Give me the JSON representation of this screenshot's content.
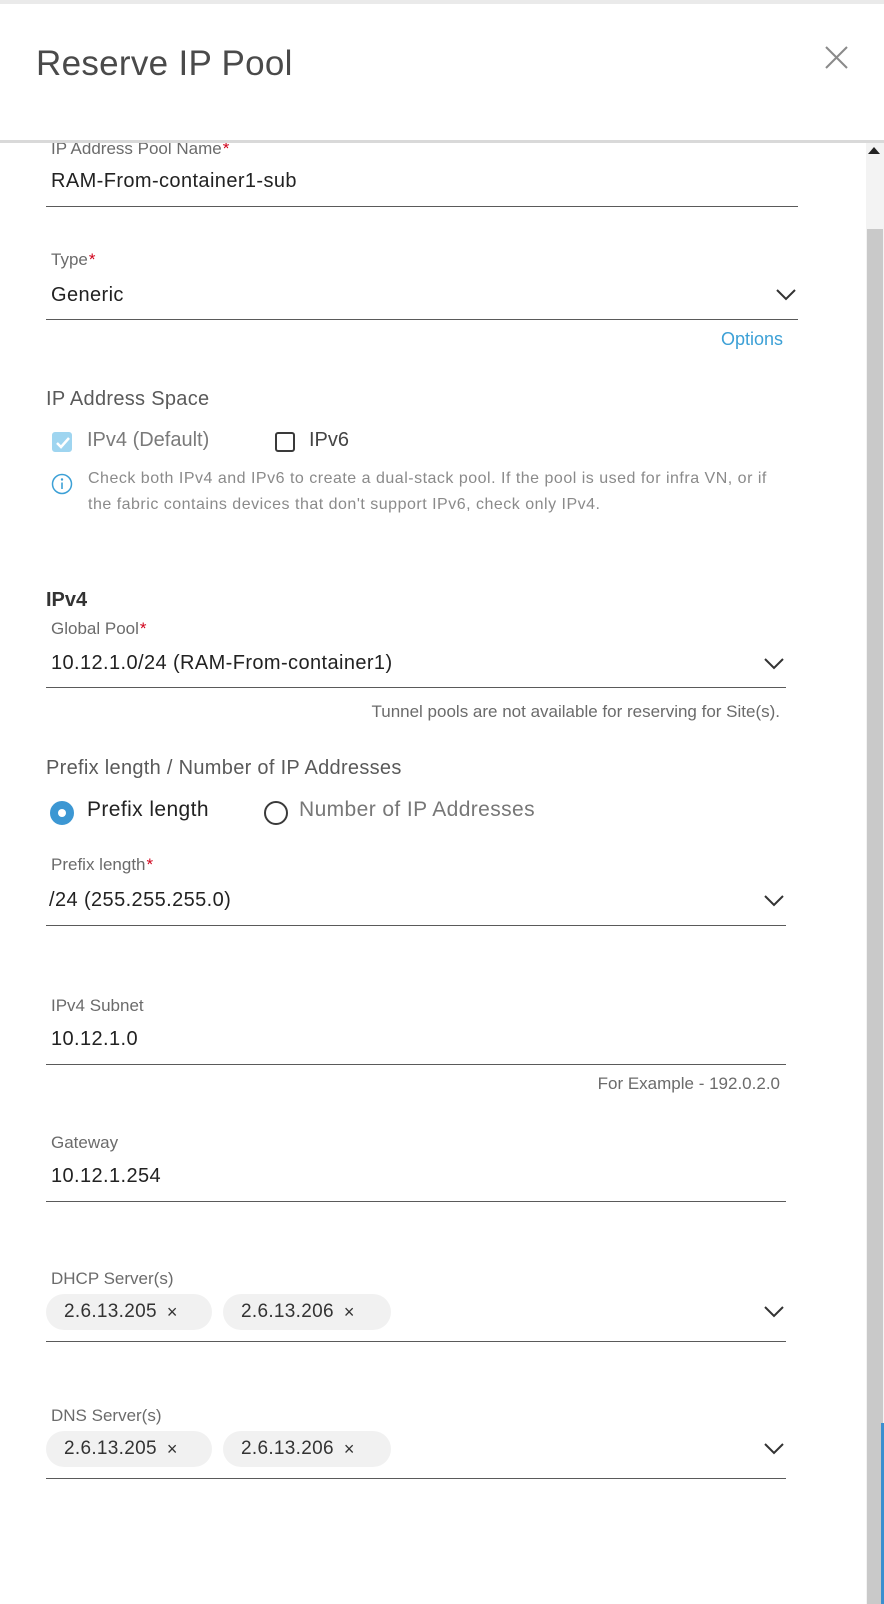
{
  "header": {
    "title": "Reserve IP Pool"
  },
  "pool_name": {
    "label": "IP Address Pool Name",
    "required": "*",
    "value": "RAM-From-container1-sub"
  },
  "type": {
    "label": "Type",
    "required": "*",
    "value": "Generic",
    "options_link": "Options"
  },
  "ip_space": {
    "title": "IP Address Space",
    "ipv4_label": "IPv4 (Default)",
    "ipv4_checked": true,
    "ipv6_label": "IPv6",
    "ipv6_checked": false,
    "info": "Check both IPv4 and IPv6 to create a dual-stack pool. If the pool is used for infra VN, or if the fabric contains devices that don't support IPv6, check only IPv4."
  },
  "ipv4": {
    "heading": "IPv4",
    "global_pool": {
      "label": "Global Pool",
      "required": "*",
      "value": "10.12.1.0/24 (RAM-From-container1)",
      "helper": "Tunnel pools are not available for reserving for Site(s)."
    },
    "prefix_mode": {
      "title": "Prefix length / Number of IP Addresses",
      "option_prefix": "Prefix length",
      "option_count": "Number of IP Addresses",
      "selected": "Prefix length"
    },
    "prefix_length": {
      "label": "Prefix length",
      "required": "*",
      "value": "/24 (255.255.255.0)"
    },
    "subnet": {
      "label": "IPv4 Subnet",
      "value": "10.12.1.0",
      "helper": "For Example - 192.0.2.0"
    },
    "gateway": {
      "label": "Gateway",
      "value": "10.12.1.254"
    },
    "dhcp": {
      "label": "DHCP Server(s)",
      "chips": [
        "2.6.13.205",
        "2.6.13.206"
      ]
    },
    "dns": {
      "label": "DNS Server(s)",
      "chips": [
        "2.6.13.205",
        "2.6.13.206"
      ]
    }
  },
  "icons": {
    "close": "close-icon",
    "chevron": "chevron-down-icon",
    "info": "info-icon",
    "chip_remove": "×"
  },
  "colors": {
    "accent": "#3c97d3",
    "link": "#3ca0d6",
    "required": "#d0021b",
    "checkbox_disabled": "#9fd5f0"
  }
}
